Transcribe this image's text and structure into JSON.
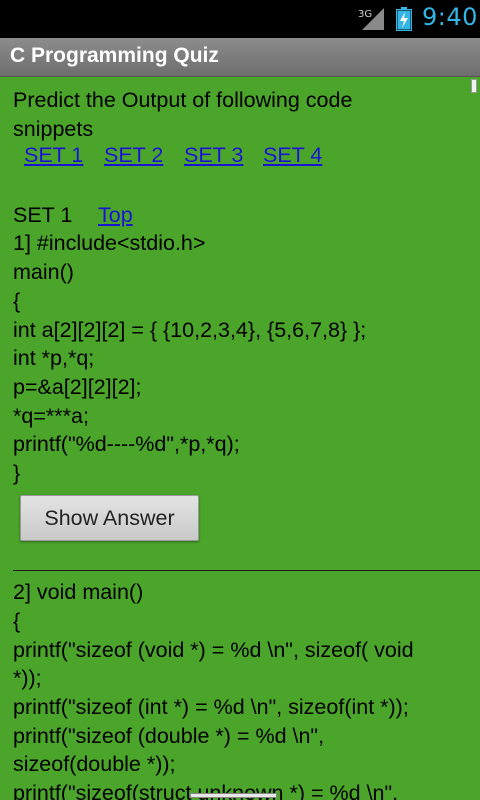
{
  "status_bar": {
    "network": "3G",
    "time": "9:40"
  },
  "app": {
    "title": "C Programming Quiz"
  },
  "intro": {
    "line1": "Predict the Output of following code",
    "line2": "snippets"
  },
  "set_links": [
    "SET 1",
    "SET 2",
    "SET 3",
    "SET 4"
  ],
  "section": {
    "heading": "SET 1",
    "top_link": "Top"
  },
  "question1": {
    "lines": [
      "1] #include<stdio.h>",
      "main()",
      "{",
      "int a[2][2][2] = { {10,2,3,4}, {5,6,7,8} };",
      "int *p,*q;",
      "p=&a[2][2][2];",
      "*q=***a;",
      "printf(\"%d----%d\",*p,*q);",
      "}"
    ],
    "show_answer_label": "Show Answer"
  },
  "question2": {
    "lines": [
      "2] void main()",
      "{",
      "printf(\"sizeof (void *) = %d \\n\", sizeof( void",
      "*));",
      "printf(\"sizeof (int *) = %d \\n\", sizeof(int *));",
      "printf(\"sizeof (double *) = %d \\n\",",
      "sizeof(double *));",
      "printf(\"sizeof(struct unknown *) = %d \\n\","
    ]
  },
  "colors": {
    "content_bg": "#4aa52a",
    "link": "#1a14d6",
    "status_accent": "#33b5e5"
  }
}
